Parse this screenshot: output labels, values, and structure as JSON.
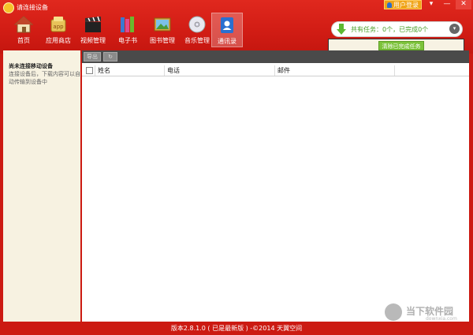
{
  "app": {
    "title": "请连接设备"
  },
  "header": {
    "login_label": "用户登录",
    "menu_icon": "▾",
    "min_icon": "—",
    "close_icon": "✕"
  },
  "nav": {
    "items": [
      {
        "label": "首页",
        "icon": "home-icon"
      },
      {
        "label": "应用商店",
        "icon": "app-store-icon"
      },
      {
        "label": "视频管理",
        "icon": "clapperboard-icon"
      },
      {
        "label": "电子书",
        "icon": "books-icon"
      },
      {
        "label": "图书管理",
        "icon": "picture-icon"
      },
      {
        "label": "音乐管理",
        "icon": "cd-icon"
      },
      {
        "label": "通讯录",
        "icon": "contacts-icon",
        "active": true
      }
    ]
  },
  "tasks": {
    "text": "共有任务：0个，已完成0个",
    "clear_label": "清除已完成任务",
    "chevron": "▾"
  },
  "sidebar": {
    "title": "尚未连接移动设备",
    "description": "连接设备后，下载内容可以自动传输到设备中"
  },
  "toolbar": {
    "export_label": "导出",
    "refresh_icon": "↻"
  },
  "table": {
    "columns": [
      "姓名",
      "电话",
      "邮件"
    ],
    "rows": []
  },
  "status": {
    "text": "版本2.8.1.0 ( 已是最新版 ) -©2014 天翼空间"
  },
  "watermark": {
    "text": "当下软件园",
    "sub": "downxia.com"
  },
  "colors": {
    "header_red": "#d11c14",
    "task_green": "#4aa02a",
    "clear_green": "#7cc23a",
    "login_orange": "#f0a418"
  }
}
